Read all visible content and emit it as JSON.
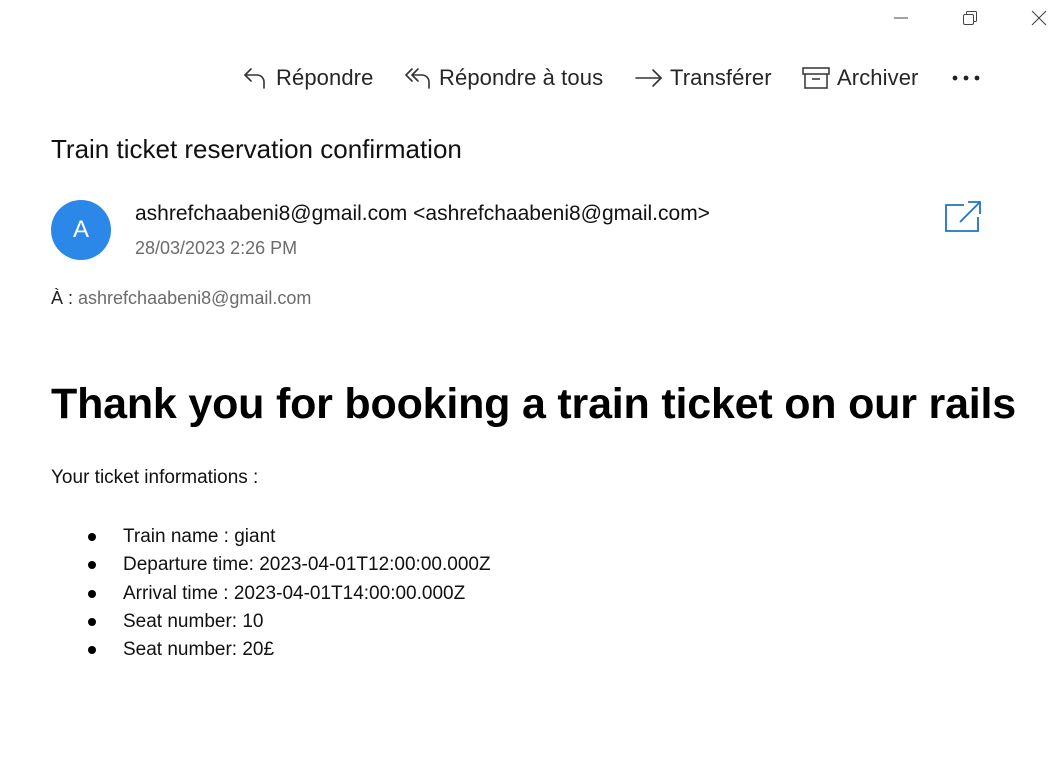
{
  "window_controls": {
    "minimize_icon": "minimize-icon",
    "restore_icon": "restore-icon",
    "close_icon": "close-icon"
  },
  "toolbar": {
    "reply_label": "Répondre",
    "reply_all_label": "Répondre à tous",
    "forward_label": "Transférer",
    "archive_label": "Archiver",
    "more_label": "•••"
  },
  "email": {
    "subject": "Train ticket reservation confirmation",
    "avatar_initial": "A",
    "avatar_color": "#2b88e8",
    "sender": "ashrefchaabeni8@gmail.com <ashrefchaabeni8@gmail.com>",
    "date": "28/03/2023 2:26 PM",
    "to_label": "À :",
    "to_value": "ashrefchaabeni8@gmail.com"
  },
  "body": {
    "headline": "Thank you for booking a train ticket on our rails",
    "intro": "Your ticket informations :",
    "details": [
      "Train name : giant",
      "Departure time: 2023-04-01T12:00:00.000Z",
      "Arrival time : 2023-04-01T14:00:00.000Z",
      "Seat number: 10",
      "Seat number: 20£"
    ]
  },
  "colors": {
    "accent": "#2b88e8",
    "muted_text": "#6b6b6b"
  }
}
